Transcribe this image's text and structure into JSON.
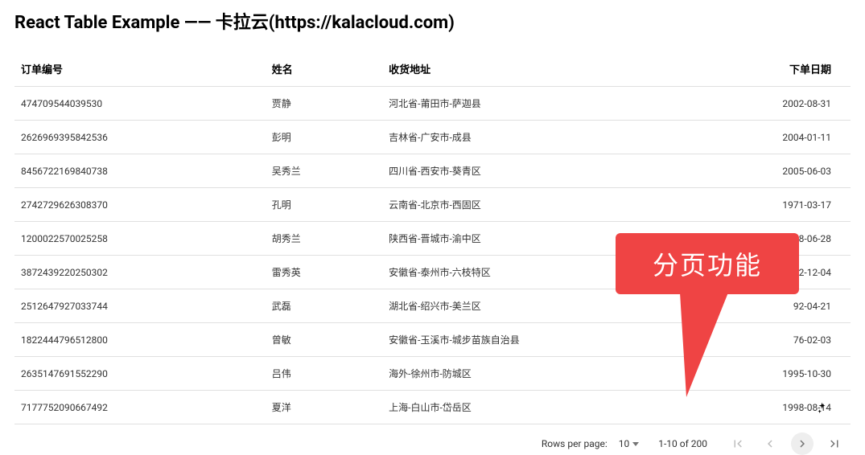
{
  "header": {
    "title": "React Table Example —— 卡拉云(https://kalacloud.com)"
  },
  "columns": {
    "id": "订单编号",
    "name": "姓名",
    "address": "收货地址",
    "date": "下单日期"
  },
  "rows": [
    {
      "id": "474709544039530",
      "name": "贾静",
      "address": "河北省-莆田市-萨迦县",
      "date": "2002-08-31"
    },
    {
      "id": "2626969395842536",
      "name": "彭明",
      "address": "吉林省-广安市-成县",
      "date": "2004-01-11"
    },
    {
      "id": "8456722169840738",
      "name": "吴秀兰",
      "address": "四川省-西安市-葵青区",
      "date": "2005-06-03"
    },
    {
      "id": "2742729626308370",
      "name": "孔明",
      "address": "云南省-北京市-西固区",
      "date": "1971-03-17"
    },
    {
      "id": "1200022570025258",
      "name": "胡秀兰",
      "address": "陕西省-晋城市-渝中区",
      "date": "1988-06-28"
    },
    {
      "id": "3872439220250302",
      "name": "雷秀英",
      "address": "安徽省-泰州市-六枝特区",
      "date": "12-12-04"
    },
    {
      "id": "2512647927033744",
      "name": "武磊",
      "address": "湖北省-绍兴市-美兰区",
      "date": "92-04-21"
    },
    {
      "id": "1822444796512800",
      "name": "曾敏",
      "address": "安徽省-玉溪市-城步苗族自治县",
      "date": "76-02-03"
    },
    {
      "id": "2635147691552290",
      "name": "吕伟",
      "address": "海外-徐州市-防城区",
      "date": "1995-10-30"
    },
    {
      "id": "7177752090667492",
      "name": "夏洋",
      "address": "上海-白山市-岱岳区",
      "date": "1998-08-14"
    }
  ],
  "pagination": {
    "rows_per_page_label": "Rows per page:",
    "rows_per_page_value": "10",
    "range_text": "1-10 of 200"
  },
  "callout": {
    "text": "分页功能"
  }
}
